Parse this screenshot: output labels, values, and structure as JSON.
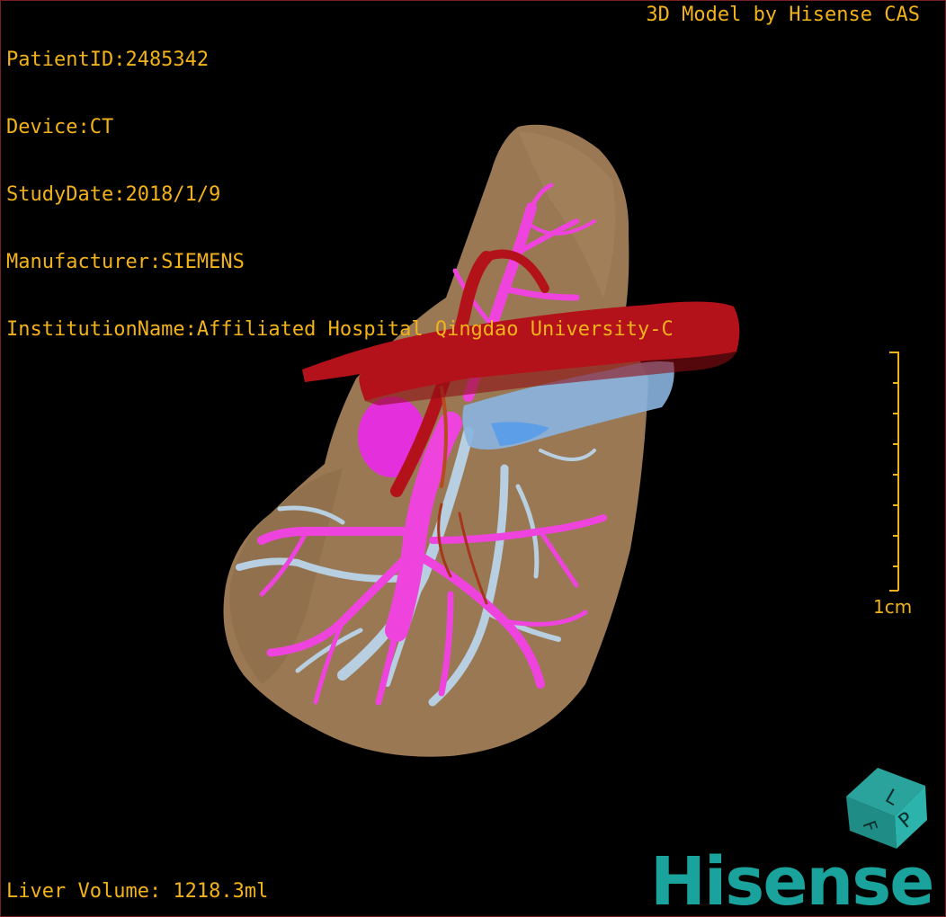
{
  "overlay": {
    "patient_id": "PatientID:2485342",
    "device": "Device:CT",
    "study_date": "StudyDate:2018/1/9",
    "manufacturer": "Manufacturer:SIEMENS",
    "institution": "InstitutionName:Affiliated Hospital Qingdao University-C",
    "brand_text": "3D Model by Hisense CAS",
    "liver_volume": "Liver Volume: 1218.3ml"
  },
  "scale_bar": {
    "label": "1cm"
  },
  "orientation_cube": {
    "faces": [
      "L",
      "P",
      "F"
    ]
  },
  "logo": {
    "text": "Hisense"
  },
  "colors": {
    "overlay_text": "#f2b21a",
    "liver": "#9c7a55",
    "artery": "#b3121a",
    "portal_vein": "#ee44dd",
    "hepatic_vein": "#b7cfe0",
    "ivc": "#5c9ee8",
    "logo": "#1aa29c"
  }
}
